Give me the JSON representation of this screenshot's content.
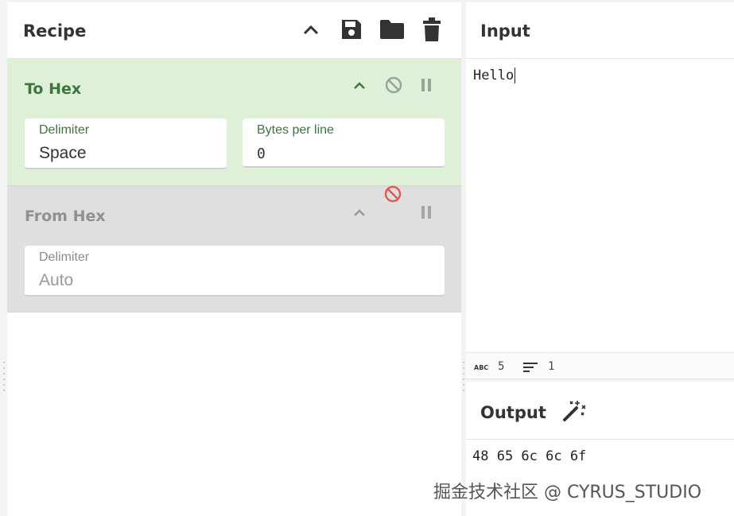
{
  "recipe": {
    "title": "Recipe",
    "icons": [
      "chevron-up-icon",
      "save-icon",
      "folder-icon",
      "trash-icon"
    ],
    "operations": [
      {
        "name": "To Hex",
        "state": "enabled",
        "fields": [
          {
            "label": "Delimiter",
            "value": "Space"
          },
          {
            "label": "Bytes per line",
            "value": "0"
          }
        ]
      },
      {
        "name": "From Hex",
        "state": "disabled",
        "fields": [
          {
            "label": "Delimiter",
            "value": "Auto"
          }
        ]
      }
    ]
  },
  "input": {
    "title": "Input",
    "text": "Hello",
    "status": {
      "length": "5",
      "lines": "1"
    }
  },
  "output": {
    "title": "Output",
    "text": "48 65 6c 6c 6f"
  },
  "watermark": "掘金技术社区 @ CYRUS_STUDIO",
  "colors": {
    "enabled_bg": "#dff0d8",
    "enabled_text": "#3c763d",
    "disabled_bg": "#dfdfdf",
    "disabled_icon": "#e05a4f"
  }
}
